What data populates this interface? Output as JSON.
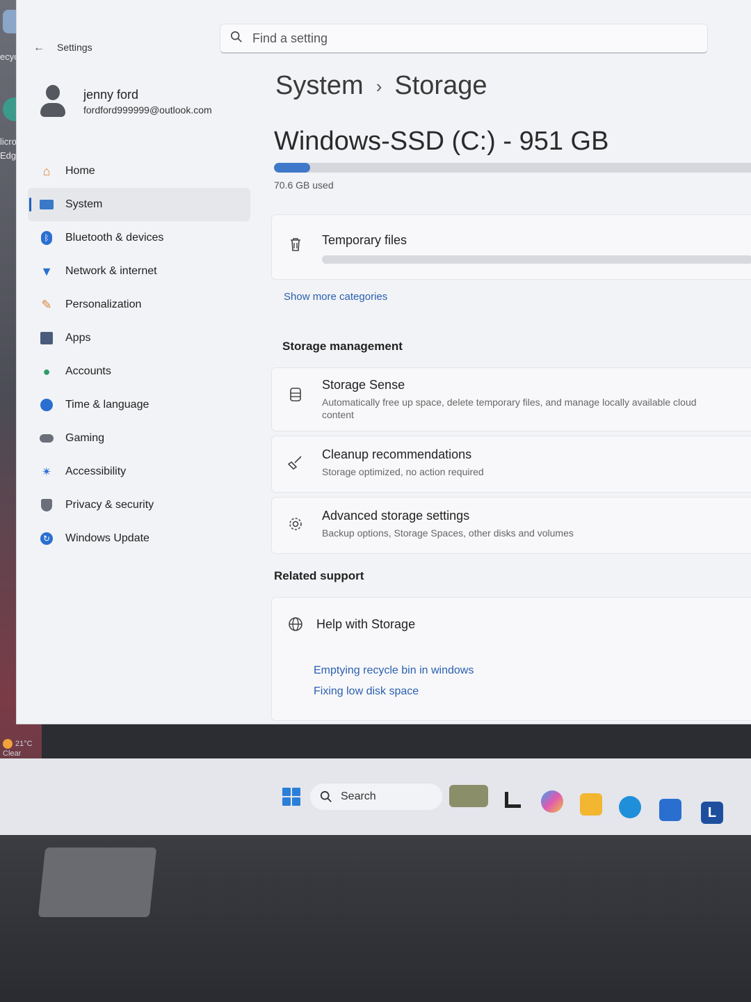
{
  "desktop": {
    "icon_labels": [
      "ecycle",
      "licros",
      "Edg"
    ],
    "weather": {
      "temp": "21°C",
      "condition": "Clear"
    }
  },
  "window": {
    "app_title": "Settings",
    "search_placeholder": "Find a setting"
  },
  "profile": {
    "name": "jenny ford",
    "email": "fordford999999@outlook.com"
  },
  "sidebar": {
    "items": [
      {
        "label": "Home",
        "icon": "home-icon"
      },
      {
        "label": "System",
        "icon": "system-icon",
        "selected": true
      },
      {
        "label": "Bluetooth & devices",
        "icon": "bluetooth-icon"
      },
      {
        "label": "Network & internet",
        "icon": "wifi-icon"
      },
      {
        "label": "Personalization",
        "icon": "brush-icon"
      },
      {
        "label": "Apps",
        "icon": "apps-icon"
      },
      {
        "label": "Accounts",
        "icon": "accounts-icon"
      },
      {
        "label": "Time & language",
        "icon": "globe-clock-icon"
      },
      {
        "label": "Gaming",
        "icon": "gamepad-icon"
      },
      {
        "label": "Accessibility",
        "icon": "accessibility-icon"
      },
      {
        "label": "Privacy & security",
        "icon": "shield-icon"
      },
      {
        "label": "Windows Update",
        "icon": "update-icon"
      }
    ]
  },
  "main": {
    "breadcrumb_parent": "System",
    "breadcrumb_sep": "›",
    "breadcrumb_current": "Storage",
    "drive_title": "Windows-SSD (C:) - 951 GB",
    "used_text": "70.6 GB used",
    "used_fraction": 0.074,
    "temp_files_label": "Temporary files",
    "show_more": "Show more categories",
    "storage_management_heading": "Storage management",
    "storage_sense": {
      "title": "Storage Sense",
      "subtitle_line1": "Automatically free up space, delete temporary files, and manage locally available cloud",
      "subtitle_line2": "content"
    },
    "cleanup": {
      "title": "Cleanup recommendations",
      "subtitle": "Storage optimized, no action required"
    },
    "advanced": {
      "title": "Advanced storage settings",
      "subtitle": "Backup options, Storage Spaces, other disks and volumes"
    },
    "related_support_heading": "Related support",
    "help_title": "Help with Storage",
    "help_links": [
      "Emptying recycle bin in windows",
      "Fixing low disk space"
    ]
  },
  "taskbar": {
    "search_label": "Search",
    "apps": [
      "widgets-icon",
      "task-view-icon",
      "copilot-icon",
      "file-explorer-icon",
      "edge-icon",
      "store-icon",
      "app-l-icon"
    ],
    "app_l_letter": "L",
    "colors": {
      "start": "#2b7fd9",
      "edge": "#1f8fd9",
      "explorer": "#f2b630",
      "store": "#2a6fd0",
      "app_l": "#1d4f9e"
    }
  }
}
